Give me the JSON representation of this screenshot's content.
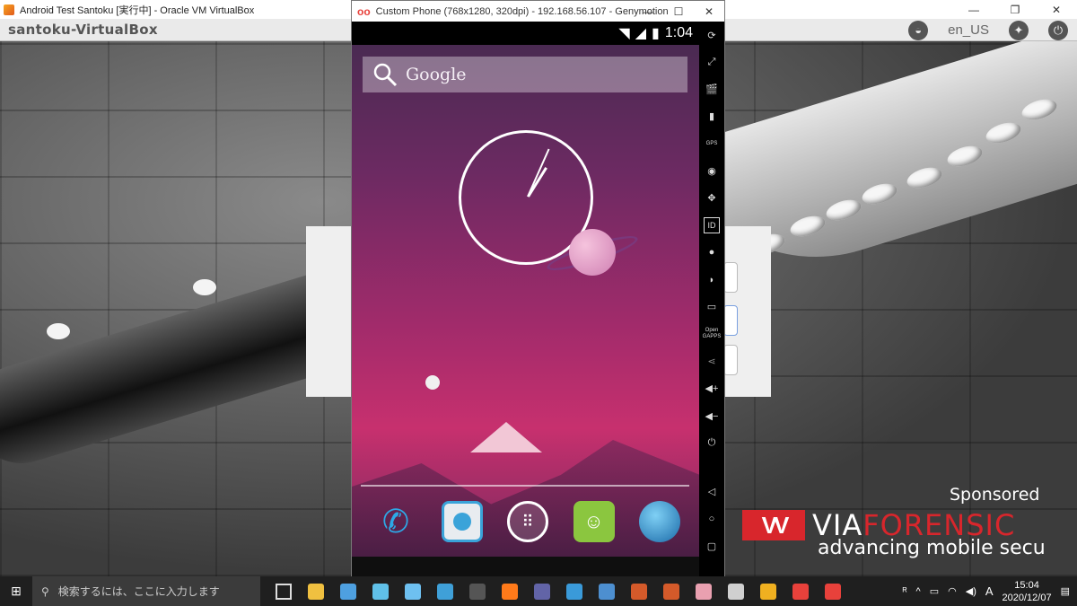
{
  "vbox": {
    "title": "Android Test Santoku [実行中] - Oracle VM VirtualBox",
    "controls": [
      "—",
      "❐",
      "✕"
    ]
  },
  "santoku": {
    "hostname": "santoku-VirtualBox",
    "lang": "en_US"
  },
  "sponsor": {
    "label": "Sponsored",
    "brand_prefix": "VIA",
    "brand_suffix": "FORENSIC",
    "tagline": "advancing mobile secu"
  },
  "genymotion": {
    "title": "Custom Phone (768x1280, 320dpi) - 192.168.56.107 - Genymotion",
    "logo": "oo",
    "controls": [
      "—",
      "☐",
      "✕"
    ]
  },
  "android": {
    "time": "1:04",
    "search_label": "Google",
    "clock": {
      "hour": 1,
      "minute": 4
    },
    "dock": [
      "phone-app",
      "contacts-app",
      "app-drawer",
      "messaging-app",
      "browser-app"
    ]
  },
  "sidebar": {
    "open_gapps": "Open GAPPS",
    "gps": "GPS",
    "id": "ID"
  },
  "taskbar": {
    "search_placeholder": "検索するには、ここに入力します",
    "time": "15:04",
    "date": "2020/12/07",
    "ime": "A",
    "colors": [
      "#f0c040",
      "#4ea0e0",
      "#60c0e8",
      "#6ec0f0",
      "#3fa0d8",
      "#555",
      "#ff7a1a",
      "#6264a7",
      "#3a9ad9",
      "#4d8fd0",
      "#d45a2a",
      "#d45a2a",
      "#e9a0b0",
      "#d0d0d0",
      "#f0b020",
      "#e8413b",
      "#e8413b"
    ]
  }
}
